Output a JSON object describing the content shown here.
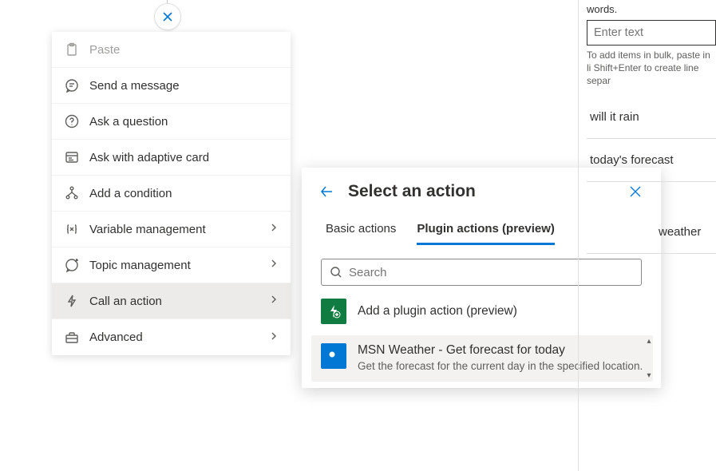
{
  "menu": {
    "items": [
      {
        "label": "Paste",
        "icon": "clipboard-icon",
        "disabled": true
      },
      {
        "label": "Send a message",
        "icon": "chat-icon"
      },
      {
        "label": "Ask a question",
        "icon": "question-icon"
      },
      {
        "label": "Ask with adaptive card",
        "icon": "card-icon"
      },
      {
        "label": "Add a condition",
        "icon": "branch-icon"
      },
      {
        "label": "Variable management",
        "icon": "variable-icon",
        "has_submenu": true
      },
      {
        "label": "Topic management",
        "icon": "topic-icon",
        "has_submenu": true
      },
      {
        "label": "Call an action",
        "icon": "lightning-icon",
        "has_submenu": true,
        "selected": true
      },
      {
        "label": "Advanced",
        "icon": "toolbox-icon",
        "has_submenu": true
      }
    ]
  },
  "flyout": {
    "title": "Select an action",
    "tabs": [
      {
        "label": "Basic actions",
        "active": false
      },
      {
        "label": "Plugin actions (preview)",
        "active": true
      }
    ],
    "search_placeholder": "Search",
    "add_plugin_label": "Add a plugin action (preview)",
    "actions": [
      {
        "title": "MSN Weather - Get forecast for today",
        "description": "Get the forecast for the current day in the specified location."
      }
    ]
  },
  "right_panel": {
    "top_label": "words.",
    "input_placeholder": "Enter text",
    "help_text": "To add items in bulk, paste in li Shift+Enter to create line separ",
    "triggers": [
      "will it rain",
      "today's forecast",
      "weather"
    ]
  }
}
